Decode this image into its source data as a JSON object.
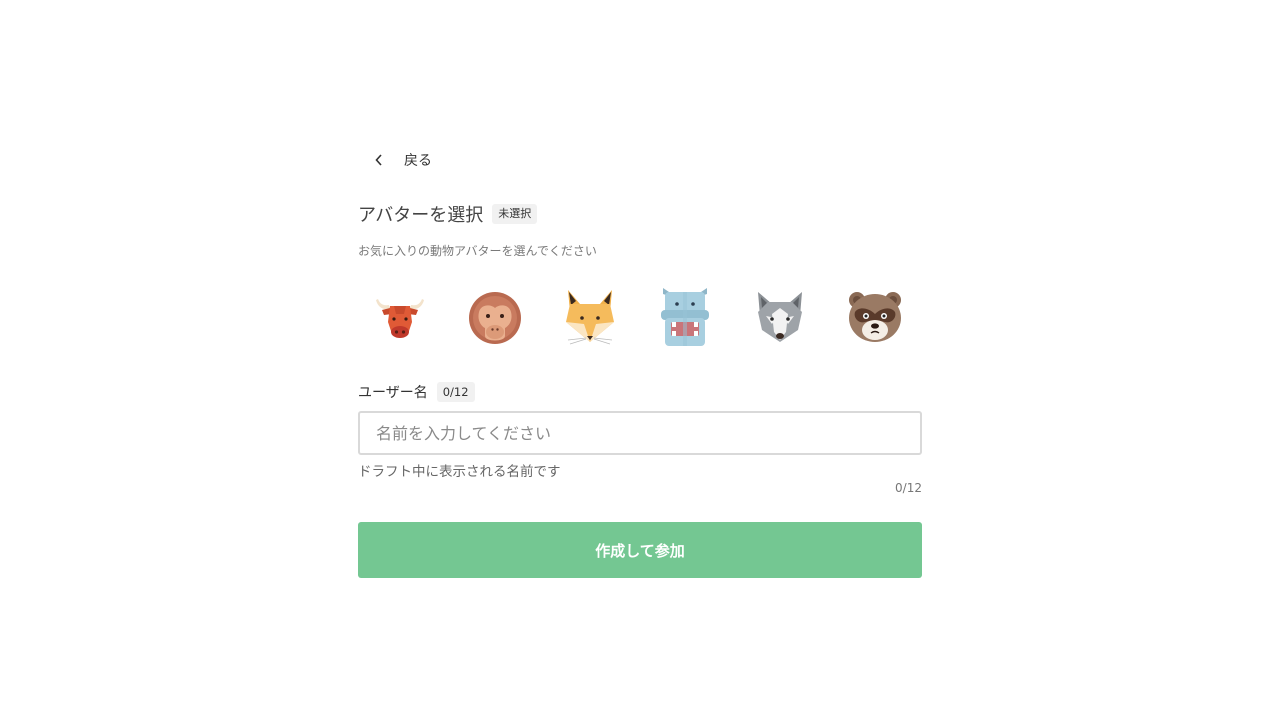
{
  "back": {
    "label": "戻る",
    "icon": "chevron-left-icon"
  },
  "avatar_section": {
    "title": "アバターを選択",
    "status_badge": "未選択",
    "subtitle": "お気に入りの動物アバターを選んでください",
    "avatars": [
      {
        "icon": "bull-icon"
      },
      {
        "icon": "monkey-icon"
      },
      {
        "icon": "fox-icon"
      },
      {
        "icon": "hippo-icon"
      },
      {
        "icon": "wolf-icon"
      },
      {
        "icon": "tanuki-icon"
      }
    ]
  },
  "username": {
    "label": "ユーザー名",
    "count_badge": "0/12",
    "placeholder": "名前を入力してください",
    "value": "",
    "helper": "ドラフト中に表示される名前です",
    "counter": "0/12"
  },
  "submit": {
    "label": "作成して参加"
  },
  "colors": {
    "accent": "#74c792",
    "badge_bg": "#f1f1f1",
    "input_border": "#d9d9d9"
  }
}
